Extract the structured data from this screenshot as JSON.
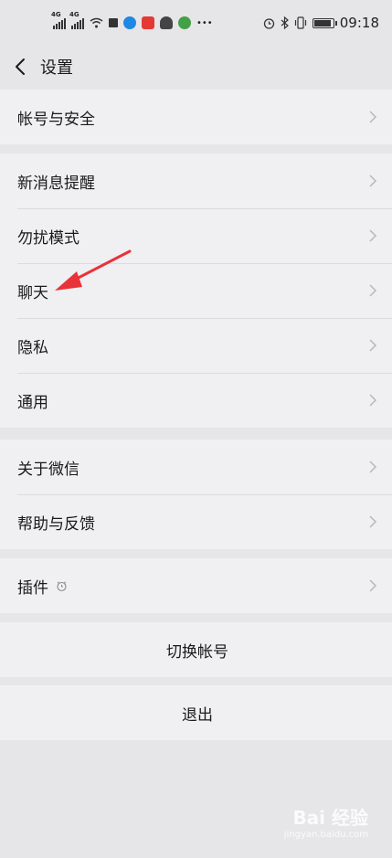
{
  "status_bar": {
    "time": "09:18",
    "network_labels": [
      "4G",
      "4G"
    ]
  },
  "nav": {
    "title": "设置"
  },
  "groups": [
    {
      "items": [
        {
          "label": "帐号与安全"
        }
      ]
    },
    {
      "items": [
        {
          "label": "新消息提醒"
        },
        {
          "label": "勿扰模式"
        },
        {
          "label": "聊天"
        },
        {
          "label": "隐私"
        },
        {
          "label": "通用"
        }
      ]
    },
    {
      "items": [
        {
          "label": "关于微信"
        },
        {
          "label": "帮助与反馈"
        }
      ]
    },
    {
      "items": [
        {
          "label": "插件"
        }
      ]
    }
  ],
  "actions": {
    "switch_account": "切换帐号",
    "logout": "退出"
  },
  "watermark": {
    "brand": "Bai 经验",
    "url": "jingyan.baidu.com"
  },
  "colors": {
    "background": "#e6e5e8",
    "row_background": "#f0eff2",
    "annotation_arrow": "#e8333a"
  }
}
